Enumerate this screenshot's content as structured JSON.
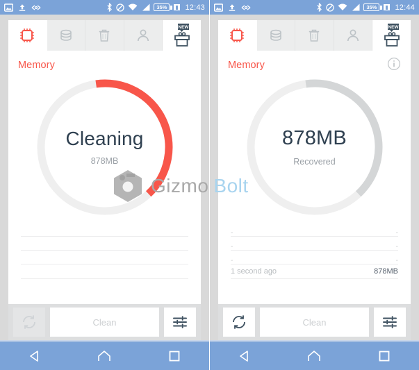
{
  "statusbar": {
    "icons_left": [
      "image-icon",
      "upload-icon",
      "usb-debug-icon"
    ],
    "icons_right": [
      "bluetooth-icon",
      "dnd-icon",
      "wifi-icon",
      "signal-icon"
    ],
    "battery_percent": "35%",
    "time_left": "12:43",
    "time_right": "12:44"
  },
  "tabs": [
    {
      "name": "memory",
      "icon": "cpu-chip-icon",
      "active": true
    },
    {
      "name": "storage",
      "icon": "database-icon",
      "active": false
    },
    {
      "name": "junk",
      "icon": "trash-icon",
      "active": false
    },
    {
      "name": "privacy",
      "icon": "person-icon",
      "active": false
    },
    {
      "name": "gift",
      "icon": "gift-box-icon",
      "badge": "NEW",
      "active": false
    }
  ],
  "left_panel": {
    "title": "Memory",
    "donut": {
      "main": "Cleaning",
      "sub": "878MB",
      "progress_color": "#f8564a",
      "track_color": "#efefef",
      "start_deg": 352,
      "sweep_deg": 145
    },
    "rows": [
      {
        "label": "",
        "value": ""
      },
      {
        "label": "",
        "value": ""
      },
      {
        "label": "",
        "value": ""
      },
      {
        "label": "",
        "value": ""
      }
    ],
    "actions": {
      "refresh_icon": "refresh-icon",
      "refresh_enabled": false,
      "clean_label": "Clean",
      "settings_icon": "sliders-icon"
    }
  },
  "right_panel": {
    "title": "Memory",
    "info_icon": "info-icon",
    "donut": {
      "main": "878MB",
      "sub": "Recovered",
      "progress_color": "#d4d6d7",
      "track_color": "#efefef",
      "start_deg": 352,
      "sweep_deg": 145
    },
    "rows": [
      {
        "label": "-",
        "value": "-"
      },
      {
        "label": "-",
        "value": "-"
      },
      {
        "label": "-",
        "value": "-"
      },
      {
        "label": "1 second ago",
        "value": "878MB"
      }
    ],
    "actions": {
      "refresh_icon": "refresh-icon",
      "refresh_enabled": true,
      "clean_label": "Clean",
      "settings_icon": "sliders-icon"
    }
  },
  "navbar": {
    "back": "back-triangle-icon",
    "home": "home-icon",
    "recents": "square-icon"
  },
  "watermark": {
    "part1": "Gizmo",
    "part2": "Bolt"
  },
  "colors": {
    "accent_red": "#f8564a",
    "status_blue": "#7ba3d8",
    "card_gray": "#d9d9d9",
    "text_dark": "#2f4050"
  }
}
